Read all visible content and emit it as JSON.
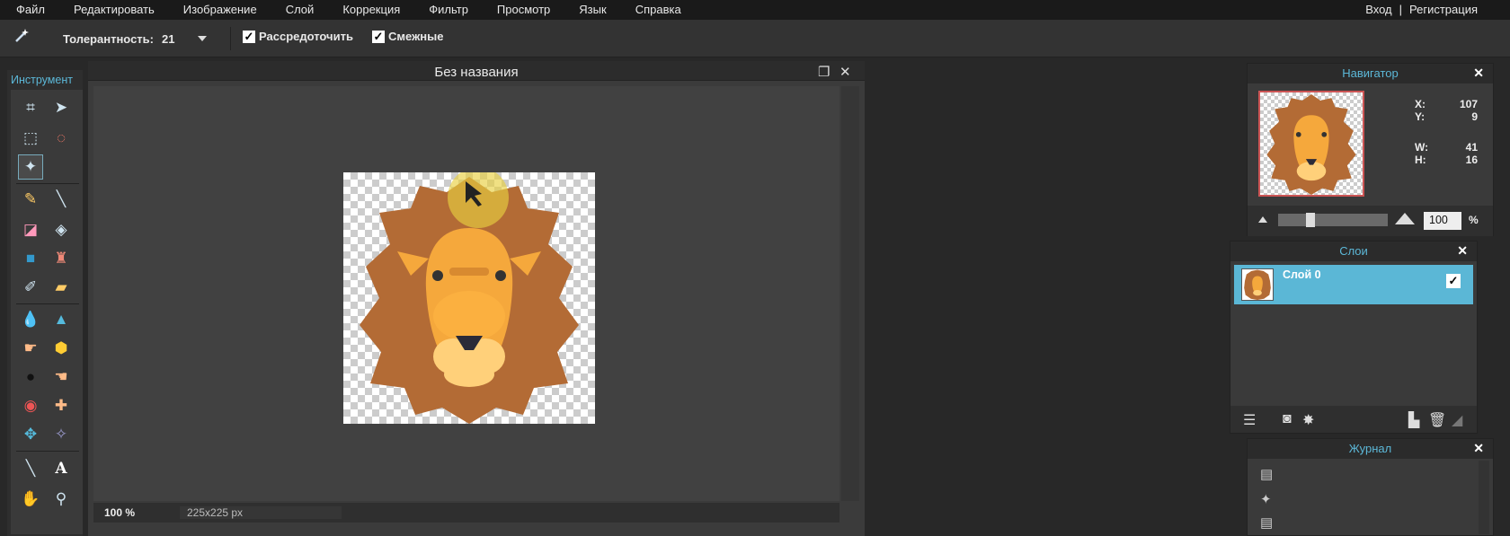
{
  "menu": {
    "items": [
      "Файл",
      "Редактировать",
      "Изображение",
      "Слой",
      "Коррекция",
      "Фильтр",
      "Просмотр",
      "Язык",
      "Справка"
    ],
    "login": "Вход",
    "separator": "|",
    "register": "Регистрация"
  },
  "options": {
    "tolerance_label": "Толерантность:",
    "tolerance_value": "21",
    "antialias_label": "Рассредоточить",
    "antialias_checked": true,
    "contiguous_label": "Смежные",
    "contiguous_checked": true,
    "check_glyph": "✓"
  },
  "tools": {
    "title": "Инструмент",
    "type_glyph": "A"
  },
  "document": {
    "title": "Без названия",
    "restore_glyph": "❐",
    "close_glyph": "✕",
    "zoom": "100",
    "zoom_unit": "%",
    "dimensions": "225x225 px"
  },
  "navigator": {
    "title": "Навигатор",
    "close": "✕",
    "x_label": "X:",
    "x_value": "107",
    "y_label": "Y:",
    "y_value": "9",
    "w_label": "W:",
    "w_value": "41",
    "h_label": "H:",
    "h_value": "16",
    "zoom_value": "100",
    "zoom_unit": "%"
  },
  "layers": {
    "title": "Слои",
    "close": "✕",
    "items": [
      {
        "name": "Слой 0",
        "visible": true
      }
    ],
    "check_glyph": "✓"
  },
  "history": {
    "title": "Журнал",
    "close": "✕"
  },
  "colors": {
    "accent": "#5cb8d8",
    "mane": "#b36b35",
    "face": "#f5a83c",
    "muzzle": "#ffd07a"
  }
}
